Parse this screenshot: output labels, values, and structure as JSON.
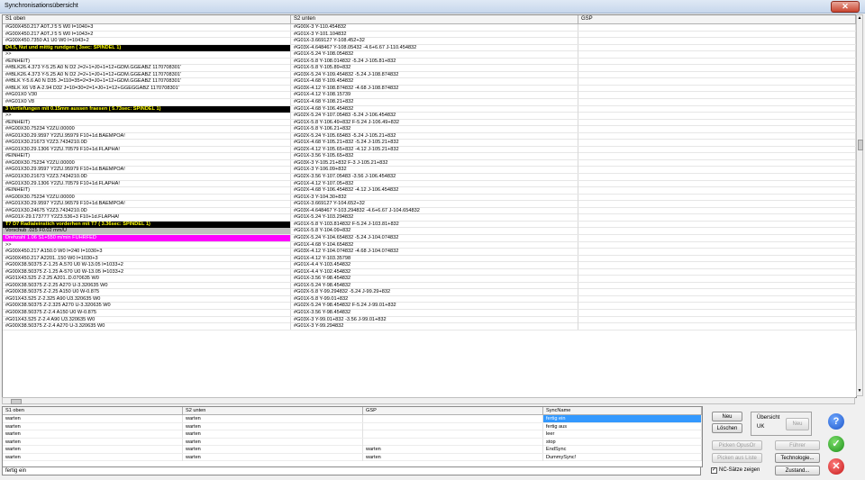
{
  "window": {
    "title": "Synchronisationsübersicht",
    "close_glyph": "✕"
  },
  "grid": {
    "columns": [
      "S1 oben",
      "S2 unten",
      "GSP"
    ],
    "rows": [
      {
        "c1": "#G00X450.217 A0T.J 5 5 W0 I=1040+3",
        "c2": "#G00X-3 Y-110.454832",
        "style": ""
      },
      {
        "c1": "#G00X450.217 A0T.J 5 5 W0 I=1043+2",
        "c2": "#G01X-3 Y-101.104832",
        "style": ""
      },
      {
        "c1": "#G00X450.7350 A1 U0 W0 I=1043+2",
        "c2": "#G01X-3.669127 Y-108.452+32",
        "style": ""
      },
      {
        "c1": "D4.5, Nut und mittig rundgen ( 3sec: SPINDEL 1)",
        "c2": "#G03X-4.648467 Y-108.05432 -4.6+6.67 J-110.454832",
        "style": "black"
      },
      {
        "c1": ">>",
        "c2": "#G01X-5.24 Y-108.054832",
        "style": ""
      },
      {
        "c1": "#EINHEIT)",
        "c2": "#G01X-5.8 Y-108.014832 -5.24 J-105.81+832",
        "style": ""
      },
      {
        "c1": "##BLK26.4.373 Y-5.25 A0 N D2 J=2+1=J0+1=12+GDM.GGEABZ 1170708301'",
        "c2": "#G01X-5.8 Y-105.89+832",
        "style": ""
      },
      {
        "c1": "##BLK26.4.373 Y-5.25 A0 N D2 J=2+1=J0+1=12+GDM.GGEABZ 1170708301'",
        "c2": "#G03X-5.24 Y-109.454832 -5.24 J-108.874832",
        "style": ""
      },
      {
        "c1": "##BLK Y-5.6 A0 N D35 J=110=35=2=3=J0+1=12+GDM.GGEABZ 1170708301'",
        "c2": "#G01X-4.68 Y-109.454832",
        "style": ""
      },
      {
        "c1": "##BLK X6 V8 A-2.94 D32 J=10=30=2=1=J0+1=12+GGEGGABZ 1170708301'",
        "c2": "#G03X-4.12 Y-108.874832 -4.68 J-108.874832",
        "style": ""
      },
      {
        "c1": "##G01X0 V30",
        "c2": "#G01X-4.12 Y-108.15739",
        "style": ""
      },
      {
        "c1": "##G01X0 V8",
        "c2": "#G01X-4.68 Y-108.21+832",
        "style": ""
      },
      {
        "c1": "3 Vertiefungen mit 0.15mm aussen fraesen ( 5.73sec: SPINDEL 1)",
        "c2": "#G01X-4.68 Y-106.454832",
        "style": "black"
      },
      {
        "c1": ">>",
        "c2": "#G02X-5.24 Y-107.05483 -5.24 J-106.454832",
        "style": ""
      },
      {
        "c1": "#EINHEIT)",
        "c2": "#G01X-5.8 Y-106.49+832 F-5.24 J-106.49+832",
        "style": ""
      },
      {
        "c1": "##G00X30.75234 Y2ZU.00000",
        "c2": "#G01X-5.8 Y-106.21+832",
        "style": ""
      },
      {
        "c1": "##G01X30.29.9597 Y2ZU.95979 F10+1d.BAEMPOA!",
        "c2": "#G02X-5.24 Y-105.65483 -5.24 J-105.21+832",
        "style": ""
      },
      {
        "c1": "##G01X30.21673 Y2Z3.7434210.0D",
        "c2": "#G01X-4.68 Y-105.21+832 -5.24 J-105.21+832",
        "style": ""
      },
      {
        "c1": "##G01X30.29.1306 Y2ZU.70579 F10+1d.FLAPHA!",
        "c2": "#G02X-4.12 Y-105.65+832 -4.12 J-105.21+832",
        "style": ""
      },
      {
        "c1": "#EINHEIT)",
        "c2": "#G01X-3.56 Y-105.65+832",
        "style": ""
      },
      {
        "c1": "##G00X30.75234 Y2ZU.00000",
        "c2": "#G03X-3 Y-105.21+832 F-3 J-105.21+832",
        "style": ""
      },
      {
        "c1": "##G01X30.29.9597 Y2ZU.95979 F10+1d.BAEMPOA!",
        "c2": "#G01X-3 Y-106.09+832",
        "style": ""
      },
      {
        "c1": "##G01X30.21673 Y2Z3.7434210.0D",
        "c2": "#G02X-3.56 Y-107.05483 -3.56 J-106.454832",
        "style": ""
      },
      {
        "c1": "##G01X30.29.1306 Y2ZU.70579 F10+1d.FLAPHA!",
        "c2": "#G01X-4.12 Y-107.05+832",
        "style": ""
      },
      {
        "c1": "#EINHEIT)",
        "c2": "#G02X-4.68 Y-106.454832 -4.12 J-106.454832",
        "style": ""
      },
      {
        "c1": "##G00X30.75234 Y2ZU.00000",
        "c2": "#G01X-3 Y-104.30+832",
        "style": ""
      },
      {
        "c1": "##G01X30.29.9597 Y2ZU.96579 F10+1d.BAEMPOA!",
        "c2": "#G01X-3.669127 Y-104.652+32",
        "style": ""
      },
      {
        "c1": "##G01X30.24675 Y2Z3.7434210.0D",
        "c2": "#G03X-4.648467 Y-103.294832 -4.6+6.67 J-104.654832",
        "style": ""
      },
      {
        "c1": "##G01X-29.173777 Y2Z3.536+3 F10+1d.FLAPHA!",
        "c2": "#G01X-5.24 Y-103.294832",
        "style": ""
      },
      {
        "c1": "T7 D7 Radialeinstich vorderhen mit T7 ( 3.36sec: SPINDEL 1)",
        "c2": "#G01X-5.8 Y-103.814832 F-5.24 J-103.81+832",
        "style": "black"
      },
      {
        "c1": "Vorschub .025 F0.02 mm/U",
        "c2": "#G01X-5.8 Y-104.09+832",
        "style": "gray"
      },
      {
        "c1": "Drehzahl 1.06 S1+550 m/min FUHRFED",
        "c2": "#G02X-5.24 Y-104.654832 -5.24 J-104.074832",
        "style": "magenta"
      },
      {
        "c1": ">>",
        "c2": "#G01X-4.68 Y-104.654832",
        "style": ""
      },
      {
        "c1": "#G00X450.217 A150.0 W0 I=240 I=1030+3",
        "c2": "#G03X-4.12 Y-104.074832 -4.68 J-104.074832",
        "style": ""
      },
      {
        "c1": "#G00X450.217 A2201..150 W0 I=1030+3",
        "c2": "#G01X-4.12 Y-103.35798",
        "style": ""
      },
      {
        "c1": "#G00X38.50375 Z-1.25 A.570 U0 W-13.05 I=1033+2",
        "c2": "#G01X-4.4 Y-103.454832",
        "style": ""
      },
      {
        "c1": "#G00X38.50375 Z-1.25 A-570 U0 W-13.05 I=1033+2",
        "c2": "#G01X-4.4 Y-102.454832",
        "style": ""
      },
      {
        "c1": "#G01X43.525 Z-2.25 A201..D.070635 W0",
        "c2": "#G01X-3.56 Y-98.454832",
        "style": ""
      },
      {
        "c1": "#G00X38.50375 Z-2.25 A270 U-3.320635 W0",
        "c2": "#G01X-5.24 Y-98.454832",
        "style": ""
      },
      {
        "c1": "#G00X38.50375 Z-2.25 A150 U0 W-0.875",
        "c2": "#G02X-5.8 Y-99.294832 -5.24 J-99.29+832",
        "style": ""
      },
      {
        "c1": "#G01X43.525 Z-2.325 A90 U3.320635 W0",
        "c2": "#G01X-5.8 Y-99.01+832",
        "style": ""
      },
      {
        "c1": "#G00X38.50375 Z-2.325 A270 U-3.320635 W0",
        "c2": "#G02X-5.24 Y-98.454832 F-5.24 J-99.01+832",
        "style": ""
      },
      {
        "c1": "#G00X38.50375 Z-2.4 A150 U0 W-0.875",
        "c2": "#G01X-3.56 Y-98.454832",
        "style": ""
      },
      {
        "c1": "#G01X43.525 Z-2.4 A90 U3.320635 W0",
        "c2": "#G03X-3 Y-99.01+832 -3.56 J-99.01+832",
        "style": ""
      },
      {
        "c1": "#G00X38.50375 Z-2.4 A270 U-3.320635 W0",
        "c2": "#G01X-3 Y-99.294832",
        "style": ""
      }
    ]
  },
  "bottom": {
    "columns": [
      "S1 oben",
      "S2 unten",
      "GSP",
      "SyncName"
    ],
    "rows": [
      {
        "c1": "warten",
        "c2": "warten",
        "c3": "",
        "c4": "fertig ein",
        "selected": true
      },
      {
        "c1": "warten",
        "c2": "warten",
        "c3": "",
        "c4": "fertig aus",
        "selected": false
      },
      {
        "c1": "warten",
        "c2": "warten",
        "c3": "",
        "c4": "leer",
        "selected": false
      },
      {
        "c1": "warten",
        "c2": "warten",
        "c3": "",
        "c4": "stop",
        "selected": false
      },
      {
        "c1": "warten",
        "c2": "warten",
        "c3": "warten",
        "c4": "EndSync",
        "selected": false
      },
      {
        "c1": "warten",
        "c2": "warten",
        "c3": "warten",
        "c4": "DummySync!",
        "selected": false
      }
    ],
    "status_text": "fertig ein"
  },
  "buttons": {
    "neu": "Neu",
    "loeschen": "Löschen",
    "uebersicht_label": "Übersicht",
    "uebersicht_value": "UK",
    "neu_disabled": "Neu",
    "picken_opus": "Picken OpusOr",
    "fuehrer": "Führer",
    "picken_liste": "Picken aus Liste",
    "technologie": "Technologie...",
    "zustand": "Zustand...",
    "nc_saetze": "NC-Sätze zeigen"
  }
}
